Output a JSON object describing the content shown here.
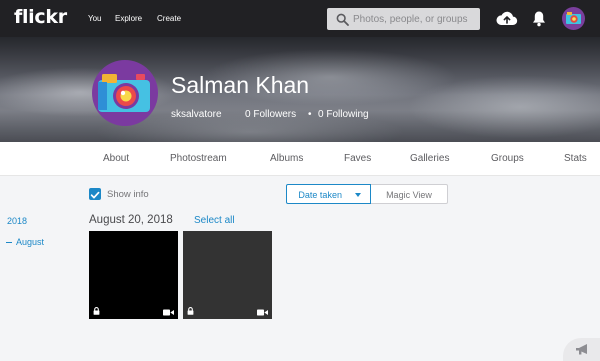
{
  "header": {
    "logo": "flickr",
    "nav": [
      "You",
      "Explore",
      "Create"
    ],
    "search_placeholder": "Photos, people, or groups"
  },
  "profile": {
    "name": "Salman Khan",
    "username": "sksalvatore",
    "followers": "0 Followers",
    "separator": "•",
    "following": "0 Following"
  },
  "tabs": [
    "About",
    "Photostream",
    "Albums",
    "Faves",
    "Galleries",
    "Groups",
    "Stats"
  ],
  "toolbar": {
    "show_info_label": "Show info",
    "show_info_checked": true,
    "date_taken_label": "Date taken",
    "magic_view_label": "Magic View"
  },
  "timeline": {
    "year": "2018",
    "month": "August"
  },
  "photostream": {
    "date_heading": "August 20, 2018",
    "select_all": "Select all",
    "items": [
      {
        "type": "video",
        "private": true,
        "color": "#000000"
      },
      {
        "type": "video",
        "private": true,
        "color": "#333333"
      }
    ]
  },
  "colors": {
    "accent": "#1c88c7",
    "topbar": "#212124",
    "background": "#f4f5f7"
  }
}
